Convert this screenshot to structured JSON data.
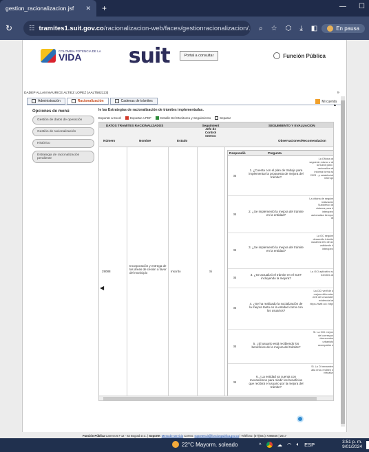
{
  "browser": {
    "tab_title": "gestion_racionalizacion.jsf",
    "tab_close": "✕",
    "new_tab": "+",
    "url_host": "tramites1.suit.gov.co",
    "url_path": "/racionalizacion-web/faces/gestionracionalizacion/...",
    "pause_label": "En pausa"
  },
  "header": {
    "logo_main": "VIDA",
    "logo_small": "COLOMBIA POTENCIA DE LA",
    "suit_logo": "suit",
    "portal_button": "Portal a consultar",
    "funcion_publica": "Función Pública"
  },
  "user_line": "DADEP ALLAN MAURICE ALTIEZ LOPEZ (AALT582123)",
  "expand_arrow": "»",
  "nav": {
    "tabs": [
      "Administración",
      "Racionalización",
      "Cadenas de trámites"
    ],
    "my_account": "Mi cuenta"
  },
  "sidebar": {
    "title": "Opciones de menú",
    "items": [
      "Gestión de datos de operación",
      "Gestión de racionalización",
      "Histórico",
      "Estrategia de racionalización pendiente"
    ]
  },
  "content": {
    "title": "le las Estrategias de racionalización de trámites implementadas.",
    "toolbar": [
      "Exportar a Excel",
      "Exportar a PDF",
      "Detalle Del Monitoreo y Seguimiento",
      "Separar"
    ],
    "group_headers": {
      "datos": "DATOS TRAMITES RACIONALIZADOS",
      "seguimiento_jefe": "Seguimient Jefe de Control Interno",
      "seguimiento": "SEGUIMIENTO Y EVALUACION"
    },
    "columns": {
      "numero": "Número",
      "nombre": "Nombre",
      "estado": "Estado",
      "observaciones": "Observaciones/Recomendacion"
    },
    "row": {
      "numero": "29088",
      "nombre": "Incorporación y entrega de las áreas de cesión a favor del municipio",
      "estado": "Inscrito",
      "seguimiento": "Si"
    },
    "inner_headers": {
      "respondio": "Respondió",
      "pregunta": "Pregunta"
    },
    "questions": [
      {
        "resp": "SI",
        "q": "1. ¿Cuenta con el plan de trabajo para implementar la propuesta de mejora del trámite?",
        "obs": "La Oficina de seguimie mismo v de la Subdi plan d racionaliza de informa forma se 2023 - p establecida interope"
      },
      {
        "resp": "SI",
        "q": "2. ¿Se implementó la mejora del trámite en la entidad?",
        "obs": "La oficina de seguimi realización Subdirecci de sistema para la interopera automatiza tiempos de"
      },
      {
        "resp": "SI",
        "q": "3. ¿Se implementó la mejora del trámite en la entidad?",
        "obs": "La OC seguimi desarrollo trámite, usuarios info de act validando la interopera"
      },
      {
        "resp": "SI",
        "q": "3. ¿Se actualizó el trámite en el SUIT incluyendo la mejora?",
        "obs": "La OCI aplicativo su trámites de"
      },
      {
        "resp": "SI",
        "q": "4. ¿Se ha realizado la socialización de la mejora tanto en la entidad como con los usuarios?",
        "obs": "La OCI verif de la mejora diferentes web de la sociales evidencia las https://twitt cd= https"
      },
      {
        "resp": "SI",
        "q": "5. ¿El usuario está recibiendo los beneficios de la mejora del trámite?",
        "obs": "Si. La OCI mejora del correspon documentos urbanístic acompañar el"
      },
      {
        "resp": "SI",
        "q": "6. ¿La entidad ya cuenta con mecanismos para medir los beneficios que recibirá el usuario por la mejora del trámite?",
        "obs": "Si. La O herramient atla encu reciben lo virtualiza"
      }
    ]
  },
  "footer": {
    "org": "Función Pública",
    "address": "Carrera 6 # 12 - 62 Bogotá D.C. |",
    "soporte_label": "Soporte:",
    "mesa": "Mesa de servicio",
    "correo_label": "Correo:",
    "email": "soportesuit@funcionpublica.gov.co",
    "telefono": "| Teléfono: (57)(601) 7395656 | 2017"
  },
  "taskbar": {
    "weather": "22°C  Mayorm. soleado",
    "lang": "ESP",
    "time": "3:51 p. m.",
    "date": "9/01/2024"
  }
}
